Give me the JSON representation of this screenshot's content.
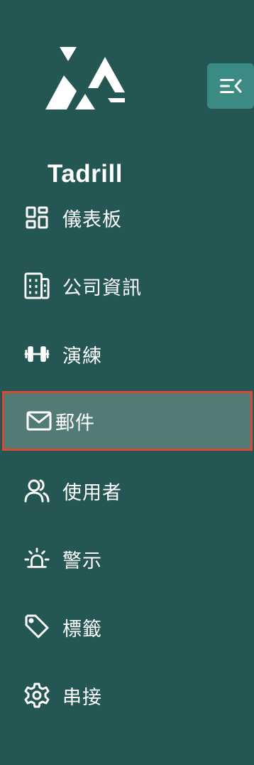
{
  "brand": {
    "name": "Tadrill"
  },
  "header": {
    "collapse_icon": "collapse-menu-icon"
  },
  "nav": {
    "items": [
      {
        "label": "儀表板",
        "icon": "dashboard-icon"
      },
      {
        "label": "公司資訊",
        "icon": "building-icon"
      },
      {
        "label": "演練",
        "icon": "dumbbell-icon"
      },
      {
        "label": "郵件",
        "icon": "mail-icon",
        "active": true
      },
      {
        "label": "使用者",
        "icon": "users-icon"
      },
      {
        "label": "警示",
        "icon": "alarm-icon"
      },
      {
        "label": "標籤",
        "icon": "tag-icon"
      },
      {
        "label": "串接",
        "icon": "settings-icon"
      }
    ]
  },
  "colors": {
    "sidebar_bg": "#245653",
    "active_bg": "#527b77",
    "active_border": "#d84a34",
    "button_bg": "#3b8a83"
  }
}
